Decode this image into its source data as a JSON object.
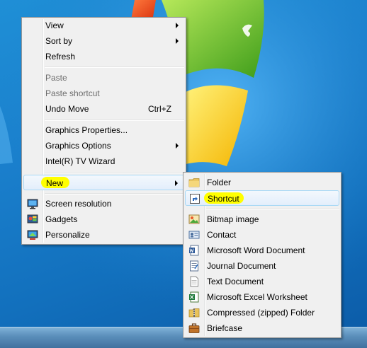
{
  "main_menu": {
    "items": [
      {
        "label": "View"
      },
      {
        "label": "Sort by"
      },
      {
        "label": "Refresh"
      },
      {
        "label": "Paste"
      },
      {
        "label": "Paste shortcut"
      },
      {
        "label": "Undo Move",
        "shortcut": "Ctrl+Z"
      },
      {
        "label": "Graphics Properties..."
      },
      {
        "label": "Graphics Options"
      },
      {
        "label": "Intel(R) TV Wizard"
      },
      {
        "label": "New"
      },
      {
        "label": "Screen resolution",
        "icon": "display-icon"
      },
      {
        "label": "Gadgets",
        "icon": "gadgets-icon"
      },
      {
        "label": "Personalize",
        "icon": "personalize-icon"
      }
    ]
  },
  "new_submenu": {
    "items": [
      {
        "label": "Folder",
        "icon": "folder-icon"
      },
      {
        "label": "Shortcut",
        "icon": "shortcut-icon"
      },
      {
        "label": "Bitmap image",
        "icon": "bitmap-icon"
      },
      {
        "label": "Contact",
        "icon": "contact-icon"
      },
      {
        "label": "Microsoft Word Document",
        "icon": "word-document-icon"
      },
      {
        "label": "Journal Document",
        "icon": "journal-icon"
      },
      {
        "label": "Text Document",
        "icon": "text-document-icon"
      },
      {
        "label": "Microsoft Excel Worksheet",
        "icon": "excel-icon"
      },
      {
        "label": "Compressed (zipped) Folder",
        "icon": "zip-folder-icon"
      },
      {
        "label": "Briefcase",
        "icon": "briefcase-icon"
      }
    ]
  },
  "colors": {
    "desktop": "#1a7fcc",
    "menu_background": "#f0f0f0",
    "menu_border": "#979797",
    "highlight_border": "#a8d8f5",
    "marker": "#ffff00",
    "disabled_text": "#6d6d6d"
  }
}
